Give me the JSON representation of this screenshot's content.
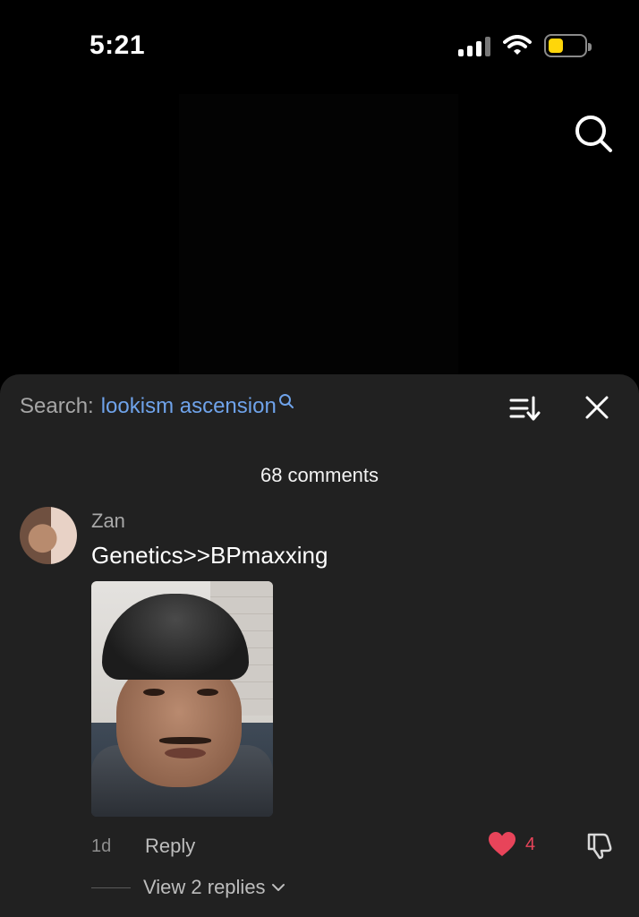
{
  "status_bar": {
    "time": "5:21"
  },
  "sheet": {
    "search_label": "Search:",
    "search_query": "lookism ascension",
    "comment_count": "68 comments"
  },
  "comment": {
    "username": "Zan",
    "text": "Genetics>>BPmaxxing",
    "age": "1d",
    "reply_label": "Reply",
    "likes": "4",
    "view_replies": "View 2 replies"
  },
  "colors": {
    "accent_link": "#6fa3ea",
    "like_red": "#e8445a",
    "battery_yellow": "#ffd60a",
    "sheet_bg": "#212121"
  },
  "icons": [
    "search-icon",
    "sort-icon",
    "close-icon",
    "heart-icon",
    "dislike-icon",
    "chevron-down-icon",
    "wifi-icon",
    "battery-icon",
    "signal-icon"
  ]
}
